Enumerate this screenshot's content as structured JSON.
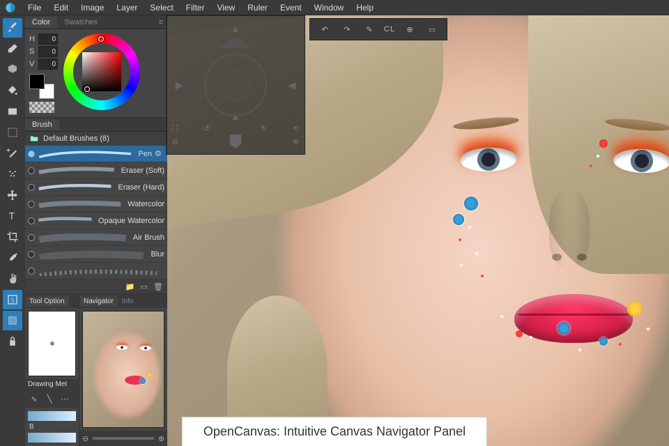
{
  "menu": [
    "File",
    "Edit",
    "Image",
    "Layer",
    "Select",
    "Filter",
    "View",
    "Ruler",
    "Event",
    "Window",
    "Help"
  ],
  "tools": [
    {
      "name": "brush-tool",
      "active": true
    },
    {
      "name": "eraser-tool"
    },
    {
      "name": "shape-tool-3d"
    },
    {
      "name": "bucket-tool"
    },
    {
      "name": "rect-tool"
    },
    {
      "name": "marquee-tool"
    },
    {
      "name": "wand-tool"
    },
    {
      "name": "spray-tool"
    },
    {
      "name": "move-tool"
    },
    {
      "name": "text-tool"
    },
    {
      "name": "crop-tool"
    },
    {
      "name": "eyedropper-tool"
    },
    {
      "name": "hand-tool"
    },
    {
      "name": "frame-tool",
      "active": true
    },
    {
      "name": "grid-tool",
      "active": true
    },
    {
      "name": "lock-tool"
    }
  ],
  "color_panel": {
    "tabs": {
      "color": "Color",
      "swatches": "Swatches"
    },
    "hsv": {
      "h": "0",
      "s": "0",
      "v": "0"
    }
  },
  "brush_panel": {
    "tab": "Brush",
    "folder": "Default Brushes (8)",
    "items": [
      {
        "label": "Pen",
        "sel": true
      },
      {
        "label": "Eraser (Soft)"
      },
      {
        "label": "Eraser (Hard)"
      },
      {
        "label": "Watercolor"
      },
      {
        "label": "Opaque Watercolor"
      },
      {
        "label": "Air Brush"
      },
      {
        "label": "Blur"
      }
    ]
  },
  "tool_option": {
    "tab": "Tool Option",
    "drawing_label": "Drawing Met",
    "b_label": "B"
  },
  "navigator": {
    "tabs": {
      "nav": "Navigator",
      "info": "Info"
    }
  },
  "top_toolbar": {
    "cl": "CL"
  },
  "caption": "OpenCanvas: Intuitive Canvas Navigator Panel"
}
